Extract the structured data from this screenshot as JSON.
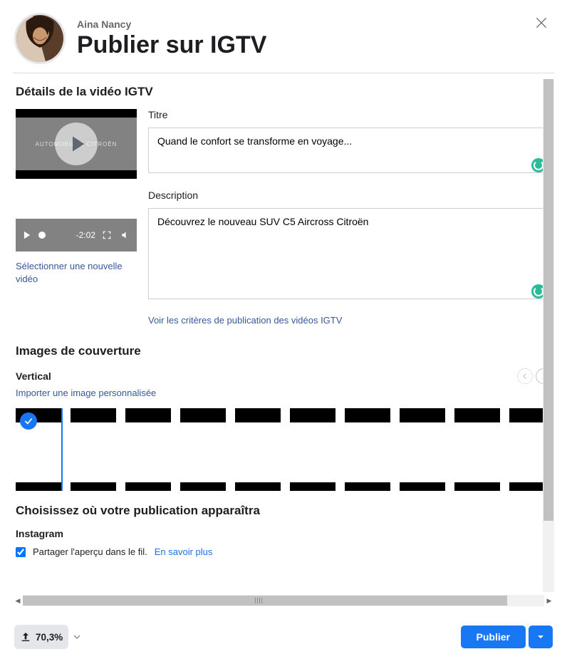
{
  "header": {
    "username": "Aina Nancy",
    "title": "Publier sur IGTV"
  },
  "details": {
    "section_title": "Détails de la vidéo IGTV",
    "title_label": "Titre",
    "title_value": "Quand le confort se transforme en voyage...",
    "description_label": "Description",
    "description_value": "Découvrez le nouveau SUV C5 Aircross Citroën",
    "criteria_link": "Voir les critères de publication des vidéos IGTV",
    "select_new_video": "Sélectionner une nouvelle vidéo",
    "video_time": "-2:02"
  },
  "cover": {
    "section_title": "Images de couverture",
    "subtitle": "Vertical",
    "import_link": "Importer une image personnalisée"
  },
  "appear": {
    "section_title": "Choisissez où votre publication apparaîtra",
    "instagram_label": "Instagram",
    "share_label": "Partager l'aperçu dans le fil.",
    "learn_more": "En savoir plus"
  },
  "footer": {
    "upload_pct": "70,3%",
    "publish_label": "Publier"
  }
}
